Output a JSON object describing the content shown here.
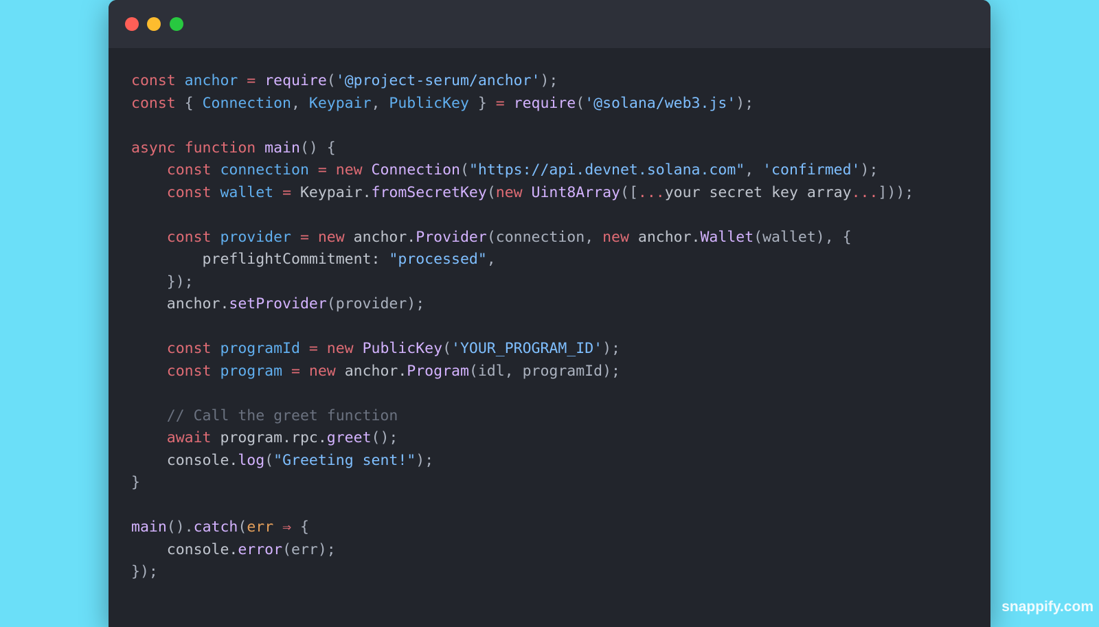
{
  "window": {
    "controls": [
      {
        "name": "close",
        "color": "#ff5f57"
      },
      {
        "name": "minimize",
        "color": "#febc2e"
      },
      {
        "name": "maximize",
        "color": "#28c840"
      }
    ]
  },
  "code": {
    "lines": [
      [
        [
          "kw",
          "const "
        ],
        [
          "var",
          "anchor"
        ],
        [
          "op",
          " = "
        ],
        [
          "fn",
          "require"
        ],
        [
          "punct",
          "("
        ],
        [
          "str",
          "'@project-serum/anchor'"
        ],
        [
          "punct",
          ");"
        ]
      ],
      [
        [
          "kw",
          "const "
        ],
        [
          "punct",
          "{ "
        ],
        [
          "var",
          "Connection"
        ],
        [
          "punct",
          ", "
        ],
        [
          "var",
          "Keypair"
        ],
        [
          "punct",
          ", "
        ],
        [
          "var",
          "PublicKey"
        ],
        [
          "punct",
          " } "
        ],
        [
          "op",
          "= "
        ],
        [
          "fn",
          "require"
        ],
        [
          "punct",
          "("
        ],
        [
          "str",
          "'@solana/web3.js'"
        ],
        [
          "punct",
          ");"
        ]
      ],
      [],
      [
        [
          "kw",
          "async "
        ],
        [
          "kw",
          "function "
        ],
        [
          "fn",
          "main"
        ],
        [
          "punct",
          "() {"
        ]
      ],
      [
        [
          "plain",
          "    "
        ],
        [
          "kw",
          "const "
        ],
        [
          "var",
          "connection"
        ],
        [
          "op",
          " = "
        ],
        [
          "kw",
          "new "
        ],
        [
          "fn",
          "Connection"
        ],
        [
          "punct",
          "("
        ],
        [
          "str",
          "\"https://api.devnet.solana.com\""
        ],
        [
          "punct",
          ", "
        ],
        [
          "str",
          "'confirmed'"
        ],
        [
          "punct",
          ");"
        ]
      ],
      [
        [
          "plain",
          "    "
        ],
        [
          "kw",
          "const "
        ],
        [
          "var",
          "wallet"
        ],
        [
          "op",
          " = "
        ],
        [
          "plain",
          "Keypair."
        ],
        [
          "fn",
          "fromSecretKey"
        ],
        [
          "punct",
          "("
        ],
        [
          "kw",
          "new "
        ],
        [
          "fn",
          "Uint8Array"
        ],
        [
          "punct",
          "(["
        ],
        [
          "op",
          "..."
        ],
        [
          "plain",
          "your secret key array"
        ],
        [
          "op",
          "..."
        ],
        [
          "punct",
          "]));"
        ]
      ],
      [],
      [
        [
          "plain",
          "    "
        ],
        [
          "kw",
          "const "
        ],
        [
          "var",
          "provider"
        ],
        [
          "op",
          " = "
        ],
        [
          "kw",
          "new "
        ],
        [
          "plain",
          "anchor."
        ],
        [
          "fn",
          "Provider"
        ],
        [
          "punct",
          "(connection, "
        ],
        [
          "kw",
          "new "
        ],
        [
          "plain",
          "anchor."
        ],
        [
          "fn",
          "Wallet"
        ],
        [
          "punct",
          "(wallet), {"
        ]
      ],
      [
        [
          "plain",
          "        preflightCommitment: "
        ],
        [
          "str",
          "\"processed\""
        ],
        [
          "punct",
          ","
        ]
      ],
      [
        [
          "punct",
          "    });"
        ]
      ],
      [
        [
          "plain",
          "    anchor."
        ],
        [
          "fn",
          "setProvider"
        ],
        [
          "punct",
          "(provider);"
        ]
      ],
      [],
      [
        [
          "plain",
          "    "
        ],
        [
          "kw",
          "const "
        ],
        [
          "var",
          "programId"
        ],
        [
          "op",
          " = "
        ],
        [
          "kw",
          "new "
        ],
        [
          "fn",
          "PublicKey"
        ],
        [
          "punct",
          "("
        ],
        [
          "str",
          "'YOUR_PROGRAM_ID'"
        ],
        [
          "punct",
          ");"
        ]
      ],
      [
        [
          "plain",
          "    "
        ],
        [
          "kw",
          "const "
        ],
        [
          "var",
          "program"
        ],
        [
          "op",
          " = "
        ],
        [
          "kw",
          "new "
        ],
        [
          "plain",
          "anchor."
        ],
        [
          "fn",
          "Program"
        ],
        [
          "punct",
          "(idl, programId);"
        ]
      ],
      [],
      [
        [
          "com",
          "    // Call the greet function"
        ]
      ],
      [
        [
          "plain",
          "    "
        ],
        [
          "kw",
          "await "
        ],
        [
          "plain",
          "program.rpc."
        ],
        [
          "fn",
          "greet"
        ],
        [
          "punct",
          "();"
        ]
      ],
      [
        [
          "plain",
          "    console."
        ],
        [
          "fn",
          "log"
        ],
        [
          "punct",
          "("
        ],
        [
          "str",
          "\"Greeting sent!\""
        ],
        [
          "punct",
          ");"
        ]
      ],
      [
        [
          "punct",
          "}"
        ]
      ],
      [],
      [
        [
          "fn",
          "main"
        ],
        [
          "punct",
          "()."
        ],
        [
          "fn",
          "catch"
        ],
        [
          "punct",
          "("
        ],
        [
          "param",
          "err"
        ],
        [
          "op",
          " ⇒ "
        ],
        [
          "punct",
          "{"
        ]
      ],
      [
        [
          "plain",
          "    console."
        ],
        [
          "fn",
          "error"
        ],
        [
          "punct",
          "(err);"
        ]
      ],
      [
        [
          "punct",
          "});"
        ]
      ]
    ]
  },
  "watermark": "snappify.com"
}
